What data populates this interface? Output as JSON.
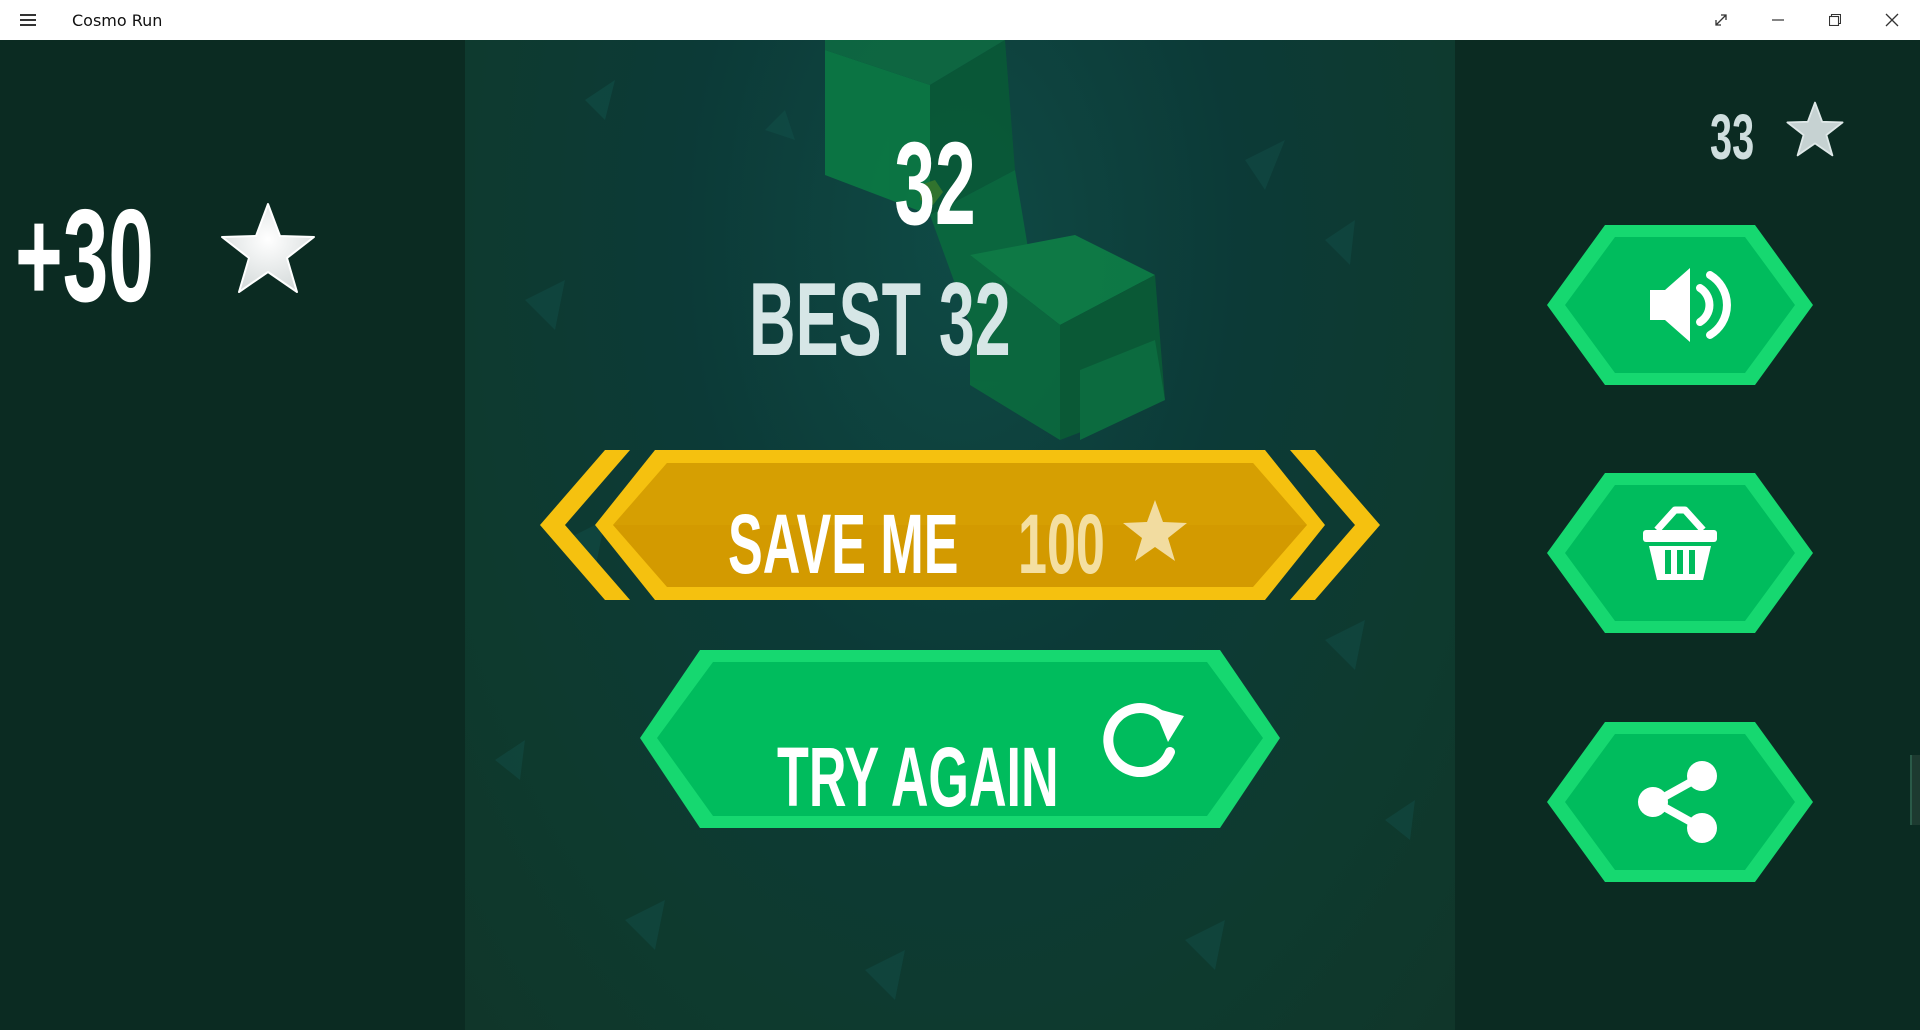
{
  "window": {
    "title": "Cosmo Run",
    "menu_icon": "hamburger-icon",
    "controls": {
      "fullscreen_icon": "expand-icon",
      "minimize_icon": "minimize-icon",
      "restore_icon": "restore-icon",
      "close_icon": "close-icon"
    }
  },
  "game": {
    "earned": "+30",
    "score": "32",
    "best": "BEST 32",
    "stars_total": "33",
    "save_me": {
      "label": "SAVE ME",
      "cost": "100"
    },
    "try_again": {
      "label": "TRY AGAIN"
    },
    "side_buttons": [
      {
        "icon": "speaker-icon"
      },
      {
        "icon": "basket-icon"
      },
      {
        "icon": "share-icon"
      }
    ]
  },
  "colors": {
    "dark_bg": "#0b2b22",
    "green": "#00c060",
    "green_border": "#16d870",
    "gold": "#d49a00",
    "gold_border": "#f5c10f"
  }
}
